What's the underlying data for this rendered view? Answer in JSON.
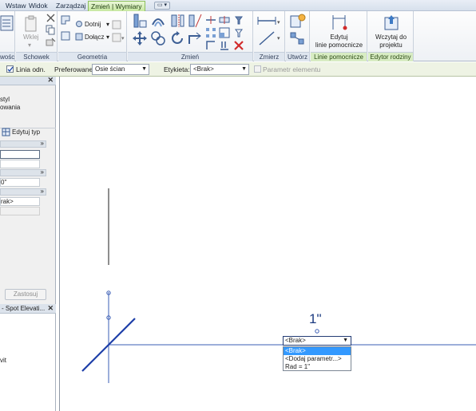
{
  "tabs": [
    {
      "label": "Wstaw",
      "active": false
    },
    {
      "label": "Widok",
      "active": false
    },
    {
      "label": "Zarządzaj",
      "active": false
    },
    {
      "label": "Zmień | Wymiary",
      "active": true
    }
  ],
  "ribbon": {
    "panels": {
      "properties_partial": "wości",
      "clipboard": "Schowek",
      "geometry": "Geometria",
      "modify": "Zmień",
      "measure": "Zmierz",
      "create": "Utwórz",
      "reference_lines": "Linie pomocnicze",
      "family_editor": "Edytor rodziny"
    },
    "buttons": {
      "paste": "Wklej",
      "cut_geometry": "Dotnij",
      "join_geometry": "Dołącz",
      "edit_reference_line": "Edytuj\nlinie pomocnicze",
      "load_into_project": "Wczytaj do\nprojektu"
    },
    "accent_colors": {
      "active_tab": "#c7e8a1",
      "panel_label": "#dfe6ef"
    }
  },
  "options_bar": {
    "reference_line_label": "Linia odn.",
    "reference_line_checked": true,
    "preferred_label": "Preferowane:",
    "preferred_value": "Osie ścian",
    "label_label": "Etykieta:",
    "label_value": "<Brak>",
    "instance_param_label": "Parametr elementu",
    "instance_param_enabled": false
  },
  "properties": {
    "line1": "styl",
    "line2": "owania",
    "edit_type": "Edytuj typ",
    "field_value_1": "0\"",
    "field_value_2": "rak>",
    "apply": "Zastosuj"
  },
  "browser": {
    "title": "- Spot Elevati...",
    "item": "vit"
  },
  "canvas": {
    "dimension_value": "1\"",
    "label_dropdown_value": "<Brak>",
    "label_options": [
      "<Brak>",
      "<Dodaj parametr...>",
      "Rad = 1\""
    ],
    "selected_option": 0
  }
}
